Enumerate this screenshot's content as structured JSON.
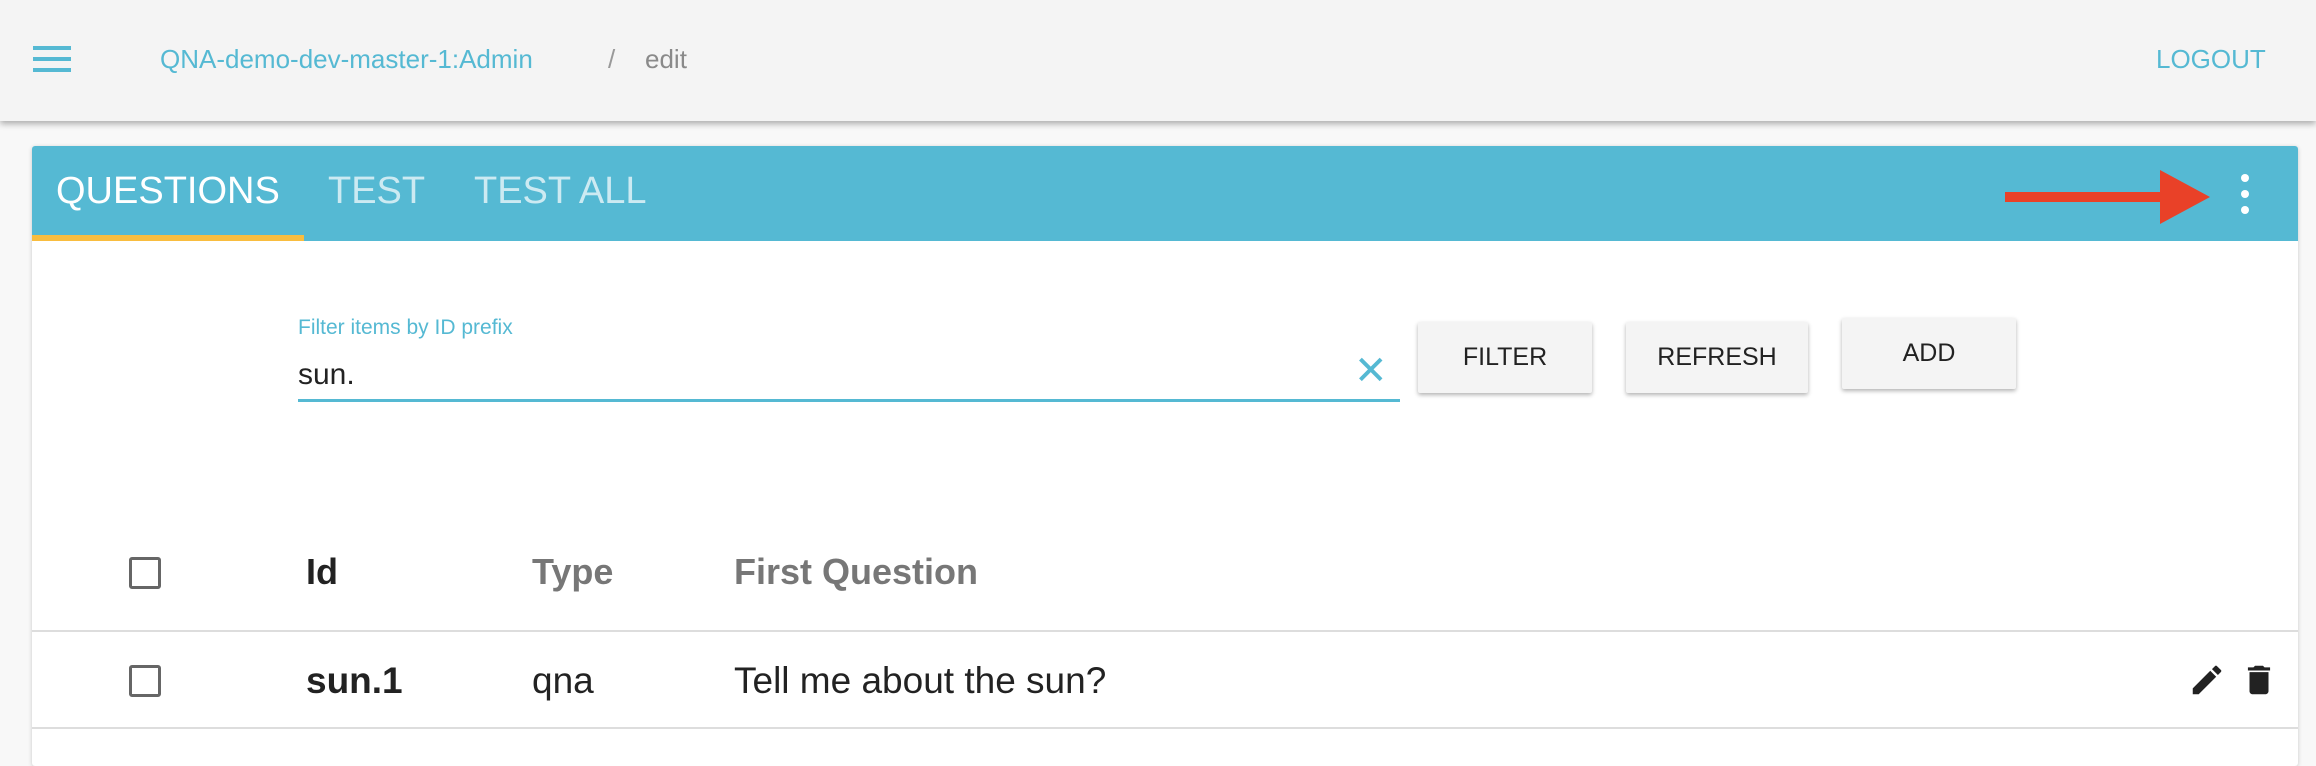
{
  "header": {
    "breadcrumb_app": "QNA-demo-dev-master-1:Admin",
    "breadcrumb_separator": "/",
    "breadcrumb_current": "edit",
    "logout_label": "LOGOUT"
  },
  "tabs": [
    {
      "label": "QUESTIONS",
      "active": true
    },
    {
      "label": "TEST",
      "active": false
    },
    {
      "label": "TEST ALL",
      "active": false
    }
  ],
  "filter": {
    "label": "Filter items by ID prefix",
    "value": "sun."
  },
  "buttons": {
    "filter": "FILTER",
    "refresh": "REFRESH",
    "add": "ADD"
  },
  "table": {
    "columns": [
      "Id",
      "Type",
      "First Question"
    ],
    "rows": [
      {
        "id": "sun.1",
        "type": "qna",
        "first_question": "Tell me about the sun?"
      }
    ]
  },
  "colors": {
    "accent": "#55b9d3",
    "tab_indicator": "#f9bd3f",
    "annotation_arrow": "#e94128"
  },
  "icons": [
    "menu-icon",
    "more-vert-icon",
    "close-icon",
    "checkbox-icon",
    "edit-pencil-icon",
    "delete-trash-icon",
    "annotation-arrow"
  ]
}
